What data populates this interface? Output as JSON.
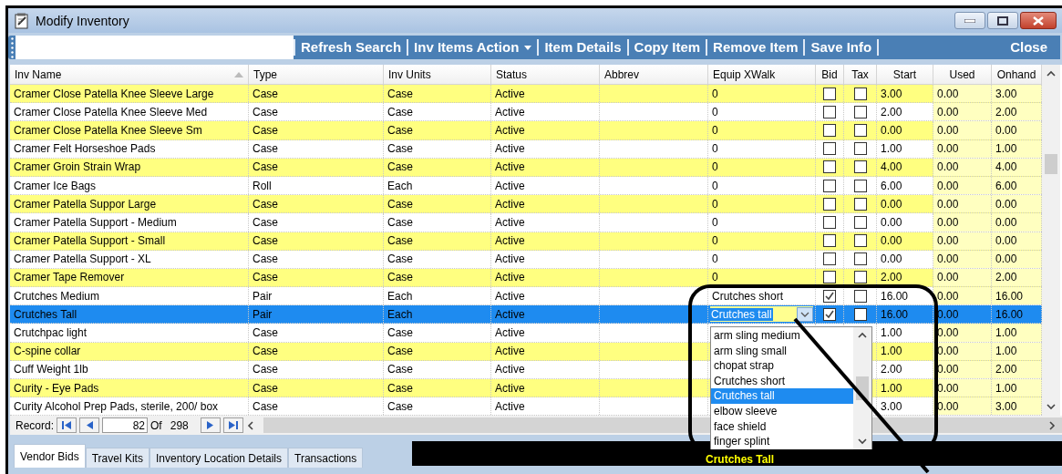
{
  "window": {
    "title": "Modify Inventory"
  },
  "toolbar": [
    {
      "label": "Refresh Search",
      "kind": "button"
    },
    {
      "label": "Inv Items Action",
      "kind": "menu"
    },
    {
      "label": "Item Details",
      "kind": "button"
    },
    {
      "label": "Copy Item",
      "kind": "button"
    },
    {
      "label": "Remove Item",
      "kind": "button"
    },
    {
      "label": "Save Info",
      "kind": "button"
    },
    {
      "label": "Close",
      "kind": "close"
    }
  ],
  "table": {
    "columns": [
      "Inv Name",
      "Type",
      "Inv Units",
      "Status",
      "Abbrev",
      "Equip XWalk",
      "Bid",
      "Tax",
      "Start",
      "Used",
      "Onhand"
    ],
    "rows": [
      {
        "name": "Cramer Close Patella Knee Sleeve Large",
        "type": "Case",
        "units": "Case",
        "status": "Active",
        "equip": "0",
        "bid": false,
        "tax": false,
        "start": "3.00",
        "used": "0.00",
        "onhand": "3.00",
        "selected": false
      },
      {
        "name": "Cramer Close Patella Knee Sleeve Med",
        "type": "Case",
        "units": "Case",
        "status": "Active",
        "equip": "0",
        "bid": false,
        "tax": false,
        "start": "2.00",
        "used": "0.00",
        "onhand": "2.00",
        "selected": false
      },
      {
        "name": "Cramer Close Patella Knee Sleeve Sm",
        "type": "Case",
        "units": "Case",
        "status": "Active",
        "equip": "0",
        "bid": false,
        "tax": false,
        "start": "0.00",
        "used": "0.00",
        "onhand": "0.00",
        "selected": false
      },
      {
        "name": "Cramer Felt Horseshoe Pads",
        "type": "Case",
        "units": "Case",
        "status": "Active",
        "equip": "0",
        "bid": false,
        "tax": false,
        "start": "1.00",
        "used": "0.00",
        "onhand": "1.00",
        "selected": false
      },
      {
        "name": "Cramer Groin Strain Wrap",
        "type": "Case",
        "units": "Case",
        "status": "Active",
        "equip": "0",
        "bid": false,
        "tax": false,
        "start": "4.00",
        "used": "0.00",
        "onhand": "4.00",
        "selected": false
      },
      {
        "name": "Cramer Ice Bags",
        "type": "Roll",
        "units": "Each",
        "status": "Active",
        "equip": "0",
        "bid": false,
        "tax": false,
        "start": "6.00",
        "used": "0.00",
        "onhand": "6.00",
        "selected": false
      },
      {
        "name": "Cramer Patella Suppor Large",
        "type": "Case",
        "units": "Case",
        "status": "Active",
        "equip": "0",
        "bid": false,
        "tax": false,
        "start": "0.00",
        "used": "0.00",
        "onhand": "0.00",
        "selected": false
      },
      {
        "name": "Cramer Patella Support - Medium",
        "type": "Case",
        "units": "Case",
        "status": "Active",
        "equip": "0",
        "bid": false,
        "tax": false,
        "start": "0.00",
        "used": "0.00",
        "onhand": "0.00",
        "selected": false
      },
      {
        "name": "Cramer Patella Support - Small",
        "type": "Case",
        "units": "Case",
        "status": "Active",
        "equip": "0",
        "bid": false,
        "tax": false,
        "start": "0.00",
        "used": "0.00",
        "onhand": "0.00",
        "selected": false
      },
      {
        "name": "Cramer Patella Support - XL",
        "type": "Case",
        "units": "Case",
        "status": "Active",
        "equip": "0",
        "bid": false,
        "tax": false,
        "start": "0.00",
        "used": "0.00",
        "onhand": "0.00",
        "selected": false
      },
      {
        "name": "Cramer Tape Remover",
        "type": "Case",
        "units": "Case",
        "status": "Active",
        "equip": "0",
        "bid": false,
        "tax": false,
        "start": "2.00",
        "used": "0.00",
        "onhand": "2.00",
        "selected": false
      },
      {
        "name": "Crutches Medium",
        "type": "Pair",
        "units": "Each",
        "status": "Active",
        "equip": "Crutches short",
        "bid": true,
        "tax": false,
        "start": "16.00",
        "used": "0.00",
        "onhand": "16.00",
        "selected": false
      },
      {
        "name": "Crutches Tall",
        "type": "Pair",
        "units": "Each",
        "status": "Active",
        "equip": "Crutches tall",
        "bid": true,
        "tax": false,
        "start": "16.00",
        "used": "0.00",
        "onhand": "16.00",
        "selected": true
      },
      {
        "name": "Crutchpac light",
        "type": "Case",
        "units": "Case",
        "status": "Active",
        "start": "1.00",
        "used": "0.00",
        "onhand": "1.00",
        "selected": false
      },
      {
        "name": "C-spine collar",
        "type": "Case",
        "units": "Case",
        "status": "Active",
        "start": "1.00",
        "used": "0.00",
        "onhand": "1.00",
        "selected": false
      },
      {
        "name": "Cuff Weight 1lb",
        "type": "Case",
        "units": "Case",
        "status": "Active",
        "start": "2.00",
        "used": "0.00",
        "onhand": "2.00",
        "selected": false
      },
      {
        "name": "Curity - Eye Pads",
        "type": "Case",
        "units": "Case",
        "status": "Active",
        "start": "1.00",
        "used": "0.00",
        "onhand": "1.00",
        "selected": false
      },
      {
        "name": "Curity Alcohol Prep Pads, sterile, 200/ box",
        "type": "Case",
        "units": "Case",
        "status": "Active",
        "start": "3.00",
        "used": "0.00",
        "onhand": "3.00",
        "selected": false
      }
    ]
  },
  "dropdown": {
    "options": [
      {
        "label": "arm sling medium",
        "selected": false
      },
      {
        "label": "arm sling small",
        "selected": false
      },
      {
        "label": "chopat strap",
        "selected": false
      },
      {
        "label": "Crutches short",
        "selected": false
      },
      {
        "label": "Crutches tall",
        "selected": true
      },
      {
        "label": "elbow sleeve",
        "selected": false
      },
      {
        "label": "face shield",
        "selected": false
      },
      {
        "label": "finger splint",
        "selected": false
      }
    ]
  },
  "record_nav": {
    "label": "Record:",
    "current": "82",
    "of": "Of",
    "total": "298"
  },
  "tabs": [
    {
      "label": "Vendor Bids",
      "selected": true
    },
    {
      "label": "Travel Kits",
      "selected": false
    },
    {
      "label": "Inventory Location Details",
      "selected": false
    },
    {
      "label": "Transactions",
      "selected": false
    }
  ],
  "detail_banner": "Crutches Tall"
}
